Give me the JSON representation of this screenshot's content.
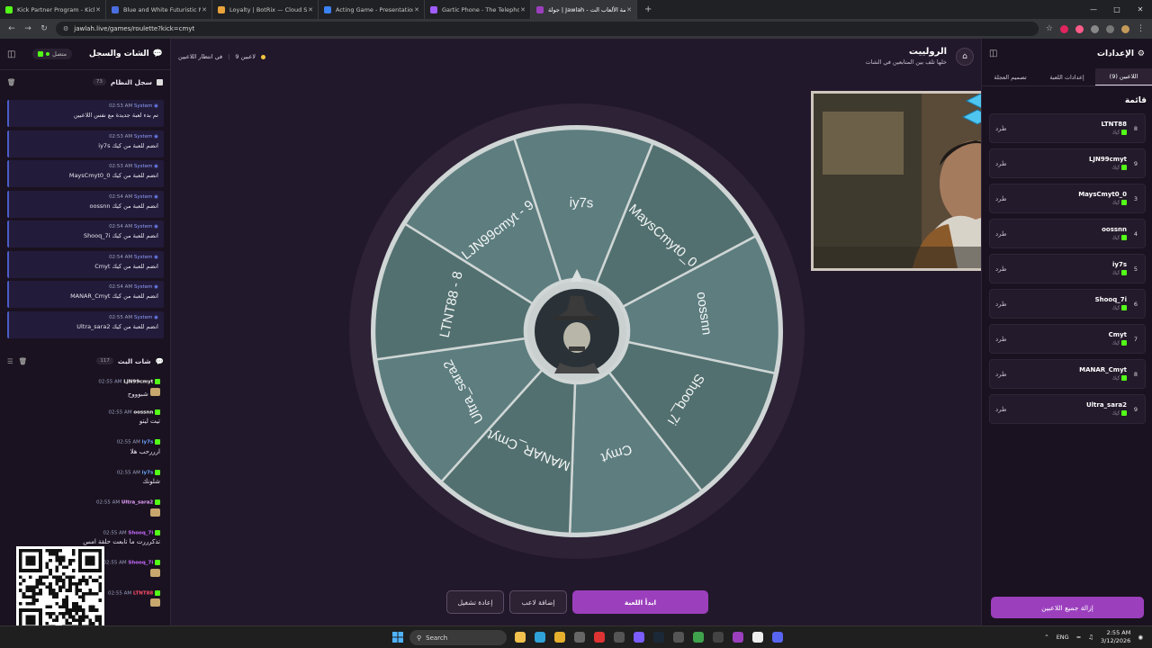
{
  "browser": {
    "tabs": [
      {
        "label": "Kick Partner Program - Kick Da",
        "color": "#53fc18",
        "active": false
      },
      {
        "label": "Blue and White Futuristic Moda",
        "color": "#4a6ee0",
        "active": false
      },
      {
        "label": "Loyalty | BotRix — Cloud Strea",
        "color": "#e8a33b",
        "active": false
      },
      {
        "label": "Acting Game - Presentation",
        "color": "#3b82f6",
        "active": false
      },
      {
        "label": "Gartic Phone - The Telephone G",
        "color": "#a05cff",
        "active": false
      },
      {
        "label": "جولة | Jawlah - منصة الألعاب الت",
        "color": "#9b3fbd",
        "active": true
      }
    ],
    "new_tab": "+",
    "url": "jawlah.live/games/roulette?kick=cmyt"
  },
  "left_panel": {
    "title": "الشات والسجل",
    "status": "متصل",
    "system_log": {
      "title": "سجل النظام",
      "count": "73",
      "messages": [
        {
          "sender": "System",
          "time": "02:53 AM",
          "text": "تم بدء لعبة جديدة مع نفس اللاعبين"
        },
        {
          "sender": "System",
          "time": "02:53 AM",
          "text": "iy7s انضم للعبة من كيك"
        },
        {
          "sender": "System",
          "time": "02:53 AM",
          "text": "MaysCmyt0_0 انضم للعبة من كيك"
        },
        {
          "sender": "System",
          "time": "02:54 AM",
          "text": "oossnn انضم للعبة من كيك"
        },
        {
          "sender": "System",
          "time": "02:54 AM",
          "text": "Shooq_7i انضم للعبة من كيك"
        },
        {
          "sender": "System",
          "time": "02:54 AM",
          "text": "Cmyt انضم للعبة من كيك"
        },
        {
          "sender": "System",
          "time": "02:54 AM",
          "text": "MANAR_Cmyt انضم للعبة من كيك"
        },
        {
          "sender": "System",
          "time": "02:55 AM",
          "text": "Ultra_sara2 انضم للعبة من كيك"
        }
      ]
    },
    "stream_chat": {
      "title": "شات البث",
      "count": "117",
      "messages": [
        {
          "user": "LJN99cmyt",
          "color": "#f0f0f0",
          "time": "02:55 AM",
          "text": "شبوووح",
          "emote": true
        },
        {
          "user": "oossnn",
          "color": "#f0f0f0",
          "time": "02:55 AM",
          "text": "تيت ليتو",
          "emote": false
        },
        {
          "user": "iy7s",
          "color": "#6aa7ff",
          "time": "02:55 AM",
          "text": "ارررحب هلا",
          "emote": false
        },
        {
          "user": "iy7s",
          "color": "#6aa7ff",
          "time": "02:55 AM",
          "text": "شلونك",
          "emote": false
        },
        {
          "user": "Ultra_sara2",
          "color": "#e6a0ff",
          "time": "02:55 AM",
          "text": "",
          "emote": true
        },
        {
          "user": "Shooq_7i",
          "color": "#c76bff",
          "time": "02:55 AM",
          "text": "تذكرررت ما تابعت حلقة امس",
          "emote": false
        },
        {
          "user": "Shooq_7i",
          "color": "#c76bff",
          "time": "02:55 AM",
          "text": "",
          "emote": true
        },
        {
          "user": "LTNT88",
          "color": "#ff4d6a",
          "time": "02:55 AM",
          "text": "",
          "emote": true
        }
      ]
    }
  },
  "center": {
    "waiting_count": "9 لاعبين",
    "waiting_label": "في انتظار اللاعبين",
    "title": "الرولييت",
    "subtitle": "خلها تلف بين المتابعين في الشات",
    "wheel_segments": [
      "iy7s",
      "MaysCmyt0_0",
      "oossnn",
      "Shooq_7i",
      "Cmyt",
      "MANAR_Cmyt",
      "Ultra_sara2",
      "LTNT88 - 8",
      "LJN99cmyt - 9"
    ],
    "buttons": {
      "restart": "إعادة تشغيل",
      "add_player": "إضافة لاعب",
      "start": "ابدأ اللعبة"
    }
  },
  "right_panel": {
    "title": "الإعدادات",
    "tabs": [
      {
        "label": "تصميم العجلة",
        "active": false
      },
      {
        "label": "إعدادات اللعبة",
        "active": false
      },
      {
        "label": "اللاعبين (9)",
        "active": true
      }
    ],
    "list_title": "قائمة",
    "kick_label": "طرد",
    "source_label": "كيك",
    "players": [
      {
        "num": "8",
        "name": "LTNT88"
      },
      {
        "num": "9",
        "name": "LJN99cmyt"
      },
      {
        "num": "3",
        "name": "MaysCmyt0_0"
      },
      {
        "num": "4",
        "name": "oossnn"
      },
      {
        "num": "5",
        "name": "iy7s"
      },
      {
        "num": "6",
        "name": "Shooq_7i"
      },
      {
        "num": "7",
        "name": "Cmyt"
      },
      {
        "num": "8",
        "name": "MANAR_Cmyt"
      },
      {
        "num": "9",
        "name": "Ultra_sara2"
      }
    ],
    "remove_all": "إزالة جميع اللاعبين"
  },
  "taskbar": {
    "search": "Search",
    "lang": "ENG",
    "time": "2:55 AM",
    "date": "3/12/2026"
  },
  "colors": {
    "accent": "#9b3fbd",
    "kick_green": "#53fc18",
    "wheel_fill": "#5d7d7f",
    "wheel_fill_alt": "#52706f"
  }
}
